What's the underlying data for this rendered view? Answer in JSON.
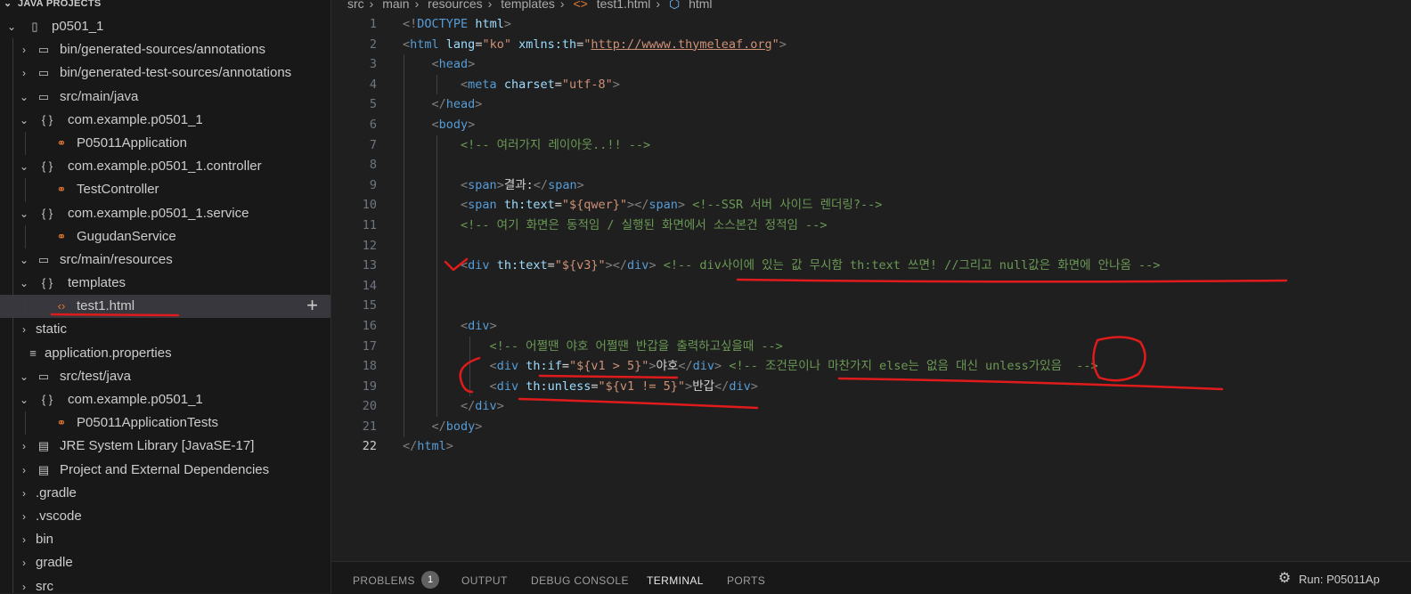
{
  "sidebar": {
    "section_title": "JAVA PROJECTS",
    "items": [
      {
        "label": "p0501_1",
        "depth": 0,
        "twistie": "down",
        "icon": "project-icon"
      },
      {
        "label": "bin/generated-sources/annotations",
        "depth": 1,
        "twistie": "right",
        "icon": "folder-package-icon"
      },
      {
        "label": "bin/generated-test-sources/annotations",
        "depth": 1,
        "twistie": "right",
        "icon": "folder-package-icon"
      },
      {
        "label": "src/main/java",
        "depth": 1,
        "twistie": "down",
        "icon": "folder-package-icon"
      },
      {
        "label": "com.example.p0501_1",
        "depth": 1,
        "twistie": "down",
        "icon": "braces-icon"
      },
      {
        "label": "P05011Application",
        "depth": 2,
        "twistie": "",
        "icon": "java-class-icon"
      },
      {
        "label": "com.example.p0501_1.controller",
        "depth": 1,
        "twistie": "down",
        "icon": "braces-icon"
      },
      {
        "label": "TestController",
        "depth": 2,
        "twistie": "",
        "icon": "java-class-icon"
      },
      {
        "label": "com.example.p0501_1.service",
        "depth": 1,
        "twistie": "down",
        "icon": "braces-icon"
      },
      {
        "label": "GugudanService",
        "depth": 2,
        "twistie": "",
        "icon": "java-class-icon"
      },
      {
        "label": "src/main/resources",
        "depth": 1,
        "twistie": "down",
        "icon": "folder-package-icon"
      },
      {
        "label": "templates",
        "depth": 1,
        "twistie": "down",
        "icon": "braces-icon"
      },
      {
        "label": "test1.html",
        "depth": 2,
        "twistie": "",
        "icon": "html-file-icon",
        "selected": true
      },
      {
        "label": "static",
        "depth": 1,
        "twistie": "right",
        "icon": ""
      },
      {
        "label": "application.properties",
        "depth": 1,
        "twistie": "",
        "icon": "properties-file-icon"
      },
      {
        "label": "src/test/java",
        "depth": 1,
        "twistie": "down",
        "icon": "folder-package-icon"
      },
      {
        "label": "com.example.p0501_1",
        "depth": 1,
        "twistie": "down",
        "icon": "braces-icon"
      },
      {
        "label": "P05011ApplicationTests",
        "depth": 2,
        "twistie": "",
        "icon": "java-class-icon"
      },
      {
        "label": "JRE System Library [JavaSE-17]",
        "depth": 1,
        "twistie": "right",
        "icon": "library-icon"
      },
      {
        "label": "Project and External Dependencies",
        "depth": 1,
        "twistie": "right",
        "icon": "library-icon"
      },
      {
        "label": ".gradle",
        "depth": 1,
        "twistie": "right",
        "icon": ""
      },
      {
        "label": ".vscode",
        "depth": 1,
        "twistie": "right",
        "icon": ""
      },
      {
        "label": "bin",
        "depth": 1,
        "twistie": "right",
        "icon": ""
      },
      {
        "label": "gradle",
        "depth": 1,
        "twistie": "right",
        "icon": ""
      },
      {
        "label": "src",
        "depth": 1,
        "twistie": "right",
        "icon": ""
      }
    ]
  },
  "breadcrumb": [
    "src",
    "main",
    "resources",
    "templates",
    "test1.html",
    "html"
  ],
  "editor": {
    "current_line": 22,
    "lines": [
      [
        [
          "t-pun",
          "<!"
        ],
        [
          "t-tag",
          "DOCTYPE"
        ],
        [
          "t-txt",
          " "
        ],
        [
          "t-attr",
          "html"
        ],
        [
          "t-pun",
          ">"
        ]
      ],
      [
        [
          "t-pun",
          "<"
        ],
        [
          "t-tag",
          "html"
        ],
        [
          "t-txt",
          " "
        ],
        [
          "t-attr",
          "lang"
        ],
        [
          "t-txt",
          "="
        ],
        [
          "t-str",
          "\"ko\""
        ],
        [
          "t-txt",
          " "
        ],
        [
          "t-attr",
          "xmlns:th"
        ],
        [
          "t-txt",
          "="
        ],
        [
          "t-str",
          "\""
        ],
        [
          "t-url",
          "http://wwww.thymeleaf.org"
        ],
        [
          "t-str",
          "\""
        ],
        [
          "t-pun",
          ">"
        ]
      ],
      [
        [
          "t-txt",
          "    "
        ],
        [
          "t-pun",
          "<"
        ],
        [
          "t-tag",
          "head"
        ],
        [
          "t-pun",
          ">"
        ]
      ],
      [
        [
          "t-txt",
          "        "
        ],
        [
          "t-pun",
          "<"
        ],
        [
          "t-tag",
          "meta"
        ],
        [
          "t-txt",
          " "
        ],
        [
          "t-attr",
          "charset"
        ],
        [
          "t-txt",
          "="
        ],
        [
          "t-str",
          "\"utf-8\""
        ],
        [
          "t-pun",
          ">"
        ]
      ],
      [
        [
          "t-txt",
          "    "
        ],
        [
          "t-pun",
          "</"
        ],
        [
          "t-tag",
          "head"
        ],
        [
          "t-pun",
          ">"
        ]
      ],
      [
        [
          "t-txt",
          "    "
        ],
        [
          "t-pun",
          "<"
        ],
        [
          "t-tag",
          "body"
        ],
        [
          "t-pun",
          ">"
        ]
      ],
      [
        [
          "t-txt",
          "        "
        ],
        [
          "t-com",
          "<!-- 여러가지 레이아웃..!! -->"
        ]
      ],
      [
        [
          "t-txt",
          ""
        ]
      ],
      [
        [
          "t-txt",
          "        "
        ],
        [
          "t-pun",
          "<"
        ],
        [
          "t-tag",
          "span"
        ],
        [
          "t-pun",
          ">"
        ],
        [
          "t-txt",
          "결과:"
        ],
        [
          "t-pun",
          "</"
        ],
        [
          "t-tag",
          "span"
        ],
        [
          "t-pun",
          ">"
        ]
      ],
      [
        [
          "t-txt",
          "        "
        ],
        [
          "t-pun",
          "<"
        ],
        [
          "t-tag",
          "span"
        ],
        [
          "t-txt",
          " "
        ],
        [
          "t-attr",
          "th:text"
        ],
        [
          "t-txt",
          "="
        ],
        [
          "t-str",
          "\"${qwer}\""
        ],
        [
          "t-pun",
          "></"
        ],
        [
          "t-tag",
          "span"
        ],
        [
          "t-pun",
          ">"
        ],
        [
          "t-txt",
          " "
        ],
        [
          "t-com",
          "<!--SSR 서버 사이드 렌더링?-->"
        ]
      ],
      [
        [
          "t-txt",
          "        "
        ],
        [
          "t-com",
          "<!-- 여기 화면은 동적임 / 실행된 화면에서 소스본건 정적임 -->"
        ]
      ],
      [
        [
          "t-txt",
          ""
        ]
      ],
      [
        [
          "t-txt",
          "        "
        ],
        [
          "t-pun",
          "<"
        ],
        [
          "t-tag",
          "div"
        ],
        [
          "t-txt",
          " "
        ],
        [
          "t-attr",
          "th:text"
        ],
        [
          "t-txt",
          "="
        ],
        [
          "t-str",
          "\"${v3}\""
        ],
        [
          "t-pun",
          "></"
        ],
        [
          "t-tag",
          "div"
        ],
        [
          "t-pun",
          ">"
        ],
        [
          "t-txt",
          " "
        ],
        [
          "t-com",
          "<!-- div사이에 있는 값 무시함 th:text 쓰면! //그리고 null값은 화면에 안나옴 -->"
        ]
      ],
      [
        [
          "t-txt",
          ""
        ]
      ],
      [
        [
          "t-txt",
          ""
        ]
      ],
      [
        [
          "t-txt",
          "        "
        ],
        [
          "t-pun",
          "<"
        ],
        [
          "t-tag",
          "div"
        ],
        [
          "t-pun",
          ">"
        ]
      ],
      [
        [
          "t-txt",
          "            "
        ],
        [
          "t-com",
          "<!-- 어쩔땐 야호 어쩔땐 반갑을 출력하고싶을때 -->"
        ]
      ],
      [
        [
          "t-txt",
          "            "
        ],
        [
          "t-pun",
          "<"
        ],
        [
          "t-tag",
          "div"
        ],
        [
          "t-txt",
          " "
        ],
        [
          "t-attr",
          "th:if"
        ],
        [
          "t-txt",
          "="
        ],
        [
          "t-str",
          "\"${v1 > 5}\""
        ],
        [
          "t-pun",
          ">"
        ],
        [
          "t-txt",
          "야호"
        ],
        [
          "t-pun",
          "</"
        ],
        [
          "t-tag",
          "div"
        ],
        [
          "t-pun",
          ">"
        ],
        [
          "t-txt",
          " "
        ],
        [
          "t-com",
          "<!-- 조건문이나 마찬가지 else는 없음 대신 unless가있음  -->"
        ]
      ],
      [
        [
          "t-txt",
          "            "
        ],
        [
          "t-pun",
          "<"
        ],
        [
          "t-tag",
          "div"
        ],
        [
          "t-txt",
          " "
        ],
        [
          "t-attr",
          "th:unless"
        ],
        [
          "t-txt",
          "="
        ],
        [
          "t-str",
          "\"${v1 != 5}\""
        ],
        [
          "t-pun",
          ">"
        ],
        [
          "t-txt",
          "반갑"
        ],
        [
          "t-pun",
          "</"
        ],
        [
          "t-tag",
          "div"
        ],
        [
          "t-pun",
          ">"
        ]
      ],
      [
        [
          "t-txt",
          "        "
        ],
        [
          "t-pun",
          "</"
        ],
        [
          "t-tag",
          "div"
        ],
        [
          "t-pun",
          ">"
        ]
      ],
      [
        [
          "t-txt",
          "    "
        ],
        [
          "t-pun",
          "</"
        ],
        [
          "t-tag",
          "body"
        ],
        [
          "t-pun",
          ">"
        ]
      ],
      [
        [
          "t-pun",
          "</"
        ],
        [
          "t-tag",
          "html"
        ],
        [
          "t-pun",
          ">"
        ]
      ]
    ]
  },
  "panel": {
    "tabs": [
      "PROBLEMS",
      "OUTPUT",
      "DEBUG CONSOLE",
      "TERMINAL",
      "PORTS"
    ],
    "active_tab": "TERMINAL",
    "problems_count": "1",
    "run_label": "Run: P05011Ap"
  },
  "colors": {
    "annotation_red": "#e01b1b",
    "background": "#1f1f1f",
    "sidebar": "#181818"
  }
}
